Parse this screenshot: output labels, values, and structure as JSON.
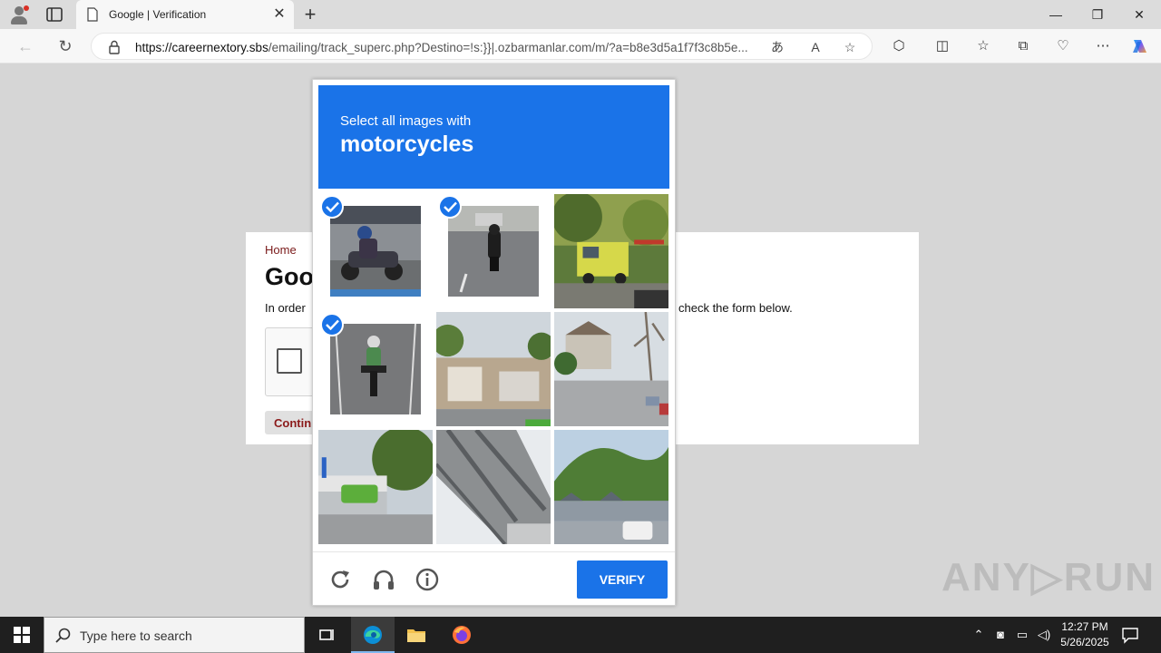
{
  "browser": {
    "tab_title": "Google | Verification",
    "new_tab": "+",
    "tab_close": "✕",
    "url_host": "https://careernextory.sbs",
    "url_path": "/emailing/track_superc.php?Destino=!s:}}|.ozbarmanlar.com/m/?a=b8e3d5a1f7f3c8b5e...",
    "window_controls": {
      "minimize": "—",
      "restore": "❐",
      "close": "✕"
    },
    "icons": [
      "back-icon",
      "refresh-icon",
      "lock-icon",
      "translate-icon",
      "read-aloud-icon",
      "favorite-icon",
      "extensions-icon",
      "split-screen-icon",
      "favorites-icon",
      "collections-icon",
      "performance-icon",
      "more-icon",
      "copilot-icon"
    ]
  },
  "page": {
    "home_link": "Home",
    "heading": "Goo",
    "text_left": "In order",
    "text_right": "check the form below.",
    "continue_label": "Contin"
  },
  "captcha": {
    "prompt": "Select all images with",
    "target": "motorcycles",
    "verify_label": "VERIFY",
    "accent_color": "#1a73e8",
    "tiles": [
      {
        "subject": "motorcycle rider",
        "selected": true
      },
      {
        "subject": "motorcycle on road",
        "selected": true
      },
      {
        "subject": "truck under trees",
        "selected": false
      },
      {
        "subject": "motorcycle rider front",
        "selected": true
      },
      {
        "subject": "street storefronts",
        "selected": false
      },
      {
        "subject": "street with houses",
        "selected": false
      },
      {
        "subject": "bus at intersection",
        "selected": false
      },
      {
        "subject": "bridge underside",
        "selected": false
      },
      {
        "subject": "hills and car",
        "selected": false
      }
    ]
  },
  "watermark": "ANY▷RUN",
  "taskbar": {
    "search_placeholder": "Type here to search",
    "time": "12:27 PM",
    "date": "5/26/2025"
  }
}
